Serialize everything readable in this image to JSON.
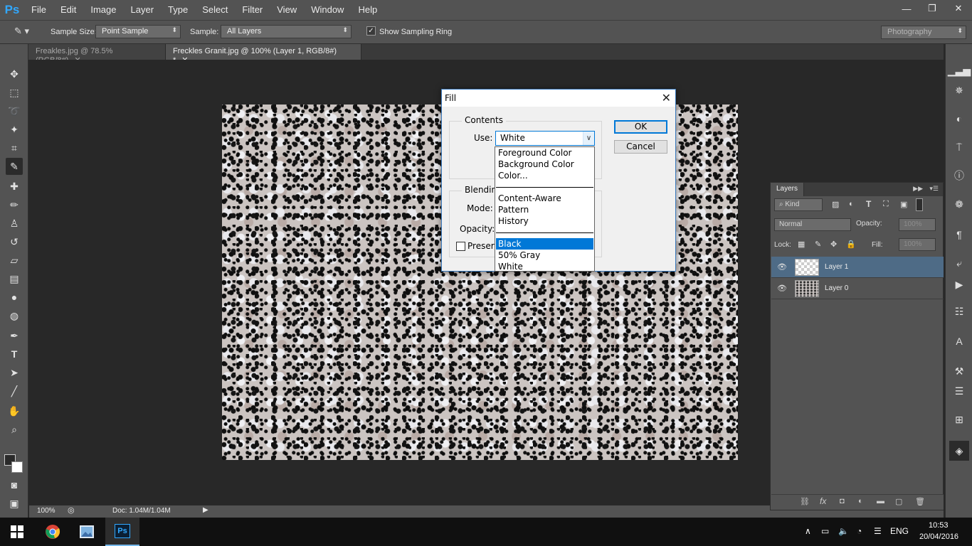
{
  "app": {
    "logo": "Ps"
  },
  "menu": [
    "File",
    "Edit",
    "Image",
    "Layer",
    "Type",
    "Select",
    "Filter",
    "View",
    "Window",
    "Help"
  ],
  "window_controls": {
    "minimize": "—",
    "restore": "❐",
    "close": "✕"
  },
  "options_bar": {
    "sample_size_label": "Sample Size:",
    "sample_size_value": "Point Sample",
    "sample_label": "Sample:",
    "sample_value": "All Layers",
    "show_ring_label": "Show Sampling Ring",
    "show_ring_checked": true,
    "workspace": "Photography"
  },
  "tabs": [
    {
      "label": "Freakles.jpg @ 78.5% (RGB/8#)",
      "close": "✕",
      "active": false
    },
    {
      "label": "Freckles Granit.jpg @ 100% (Layer 1, RGB/8#) *",
      "close": "✕",
      "active": true
    }
  ],
  "status_bar": {
    "zoom": "100%",
    "doc": "Doc: 1.04M/1.04M"
  },
  "fill_dialog": {
    "title": "Fill",
    "contents_label": "Contents",
    "use_label": "Use:",
    "use_value": "White",
    "blending_label": "Blendin",
    "mode_label": "Mode:",
    "opacity_label": "Opacity:",
    "preserve_label": "Preserv",
    "ok": "OK",
    "cancel": "Cancel"
  },
  "use_options": {
    "group1": [
      "Foreground Color",
      "Background Color",
      "Color..."
    ],
    "group2": [
      "Content-Aware",
      "Pattern",
      "History"
    ],
    "group3": [
      "Black",
      "50% Gray",
      "White"
    ],
    "highlighted": "Black"
  },
  "layers_panel": {
    "title": "Layers",
    "kind_label": "Kind",
    "blend_mode": "Normal",
    "opacity_label": "Opacity:",
    "opacity_value": "100%",
    "lock_label": "Lock:",
    "fill_label": "Fill:",
    "fill_value": "100%",
    "layers": [
      {
        "name": "Layer 1",
        "selected": true,
        "thumb": "transparent"
      },
      {
        "name": "Layer 0",
        "selected": false,
        "thumb": "granite"
      }
    ]
  },
  "taskbar": {
    "apps": [
      "chrome-icon",
      "photos-icon",
      "photoshop-icon"
    ],
    "ps_label": "Ps",
    "language": "ENG",
    "time": "10:53",
    "date": "20/04/2016"
  },
  "colors": {
    "accent": "#0078d7",
    "ps_blue": "#31a8ff",
    "panel": "#535353",
    "workspace": "#282828",
    "layer_selected": "#4e6b86"
  }
}
